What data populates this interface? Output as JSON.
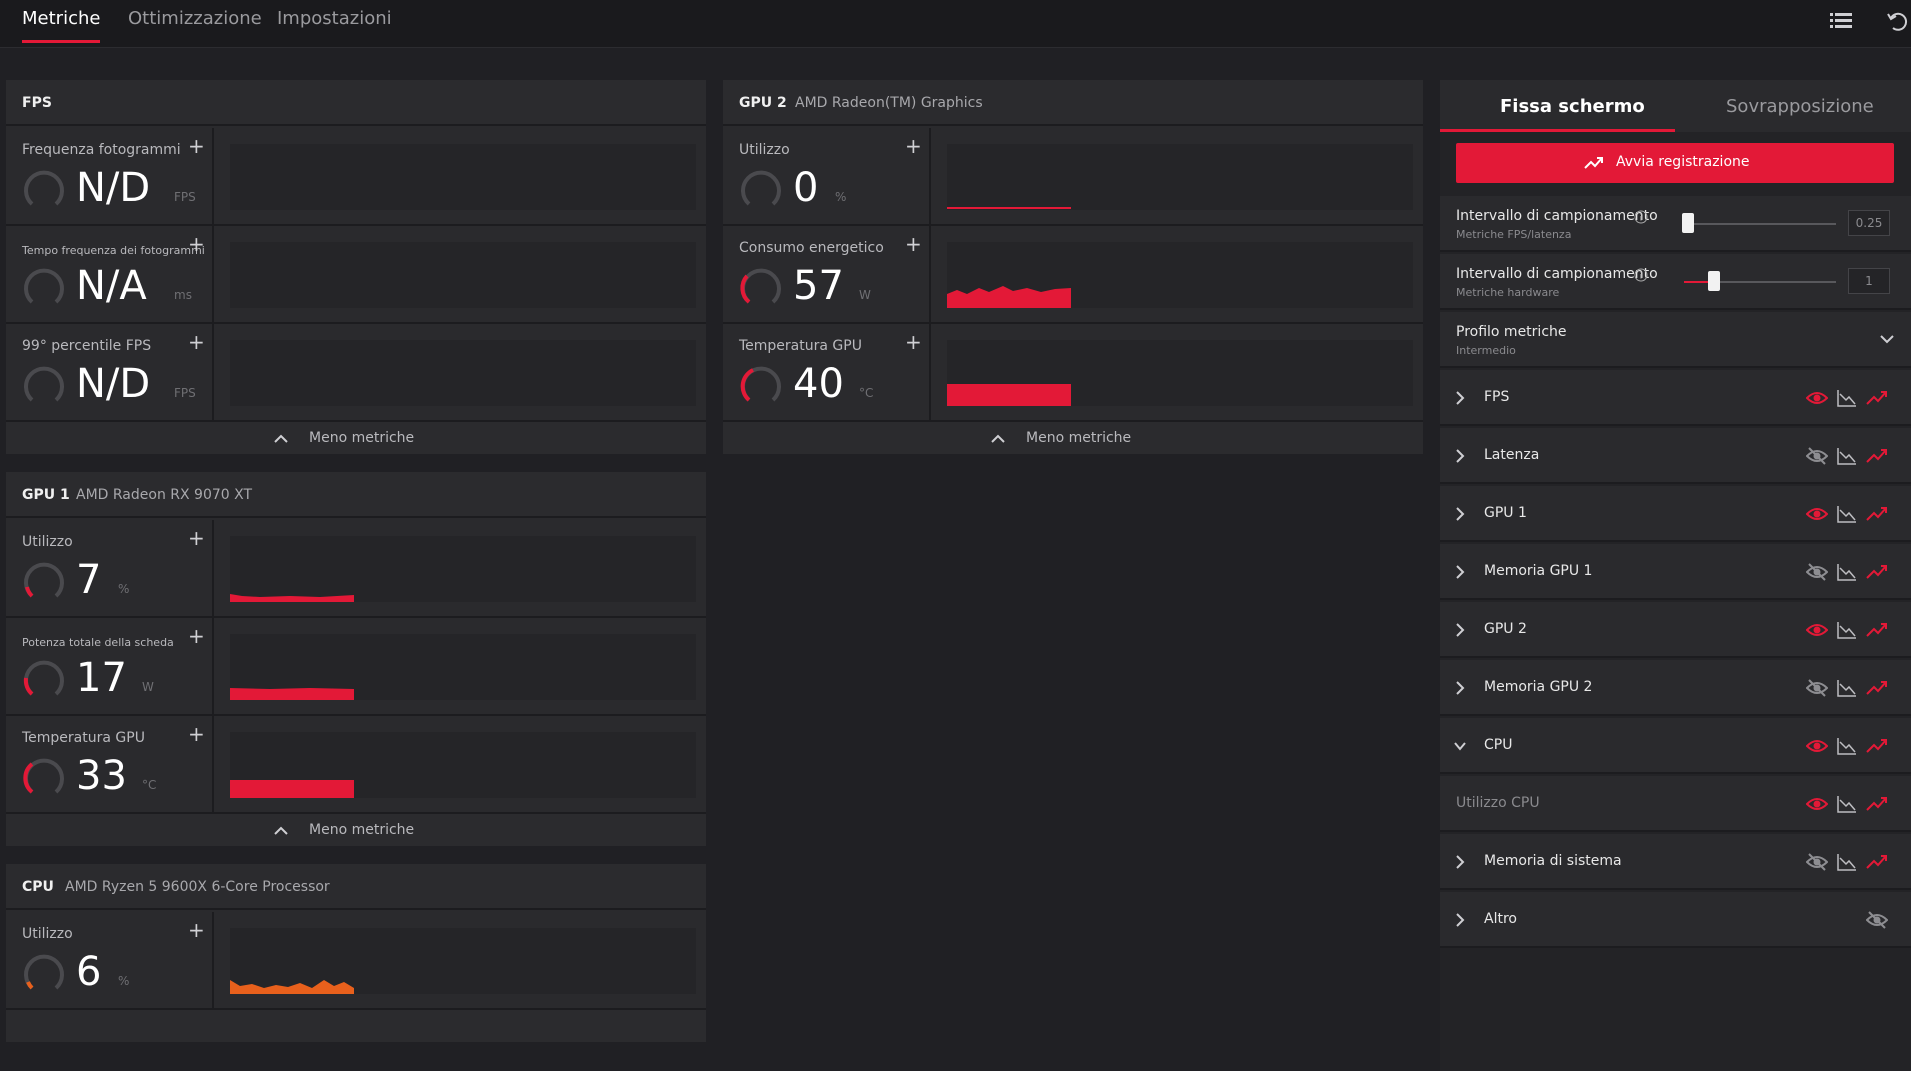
{
  "nav": {
    "tabs": [
      {
        "label": "Metriche",
        "active": true
      },
      {
        "label": "Ottimizzazione",
        "active": false
      },
      {
        "label": "Impostazioni",
        "active": false
      }
    ]
  },
  "colors": {
    "accent": "#e31937",
    "graph_red": "#e31937",
    "graph_orange": "#e8601c",
    "panel_bg": "#2a2a2d",
    "app_bg": "#202024"
  },
  "fps_panel": {
    "title": "FPS",
    "metrics": [
      {
        "name": "Frequenza fotogrammi",
        "value": "N/D",
        "unit": "FPS"
      },
      {
        "name": "Tempo frequenza dei fotogrammi",
        "value": "N/A",
        "unit": "ms"
      },
      {
        "name": "99° percentile FPS",
        "value": "N/D",
        "unit": "FPS"
      }
    ],
    "footer": "Meno metriche"
  },
  "gpu2_panel": {
    "title": "GPU 2",
    "subtitle": "AMD Radeon(TM) Graphics",
    "metrics": [
      {
        "name": "Utilizzo",
        "value": "0",
        "unit": "%"
      },
      {
        "name": "Consumo energetico",
        "value": "57",
        "unit": "W"
      },
      {
        "name": "Temperatura GPU",
        "value": "40",
        "unit": "°C"
      }
    ],
    "footer": "Meno metriche"
  },
  "gpu1_panel": {
    "title": "GPU 1",
    "subtitle": "AMD Radeon RX 9070 XT",
    "metrics": [
      {
        "name": "Utilizzo",
        "value": "7",
        "unit": "%"
      },
      {
        "name": "Potenza totale della scheda",
        "value": "17",
        "unit": "W"
      },
      {
        "name": "Temperatura GPU",
        "value": "33",
        "unit": "°C"
      }
    ],
    "footer": "Meno metriche"
  },
  "cpu_panel": {
    "title": "CPU",
    "subtitle": "AMD Ryzen 5 9600X 6-Core Processor",
    "metrics": [
      {
        "name": "Utilizzo",
        "value": "6",
        "unit": "%"
      }
    ]
  },
  "sidebar": {
    "tabs": [
      {
        "label": "Fissa schermo",
        "active": true
      },
      {
        "label": "Sovrapposizione",
        "active": false
      }
    ],
    "record_button": "Avvia registrazione",
    "sampling_fps": {
      "label": "Intervallo di campionamento",
      "sub": "Metriche FPS/latenza",
      "value": "0.25"
    },
    "sampling_hw": {
      "label": "Intervallo di campionamento",
      "sub": "Metriche hardware",
      "value": "1"
    },
    "profile": {
      "label": "Profilo metriche",
      "value": "Intermedio"
    },
    "categories": [
      {
        "label": "FPS",
        "visible": true,
        "expanded": false
      },
      {
        "label": "Latenza",
        "visible": false,
        "expanded": false
      },
      {
        "label": "GPU 1",
        "visible": true,
        "expanded": false
      },
      {
        "label": "Memoria GPU 1",
        "visible": false,
        "expanded": false
      },
      {
        "label": "GPU 2",
        "visible": true,
        "expanded": false
      },
      {
        "label": "Memoria GPU 2",
        "visible": false,
        "expanded": false
      },
      {
        "label": "CPU",
        "visible": true,
        "expanded": true
      },
      {
        "label": "Utilizzo CPU",
        "visible": true,
        "sub": true
      },
      {
        "label": "Memoria di sistema",
        "visible": false,
        "expanded": false
      },
      {
        "label": "Altro",
        "visible": false,
        "expanded": false
      }
    ]
  }
}
